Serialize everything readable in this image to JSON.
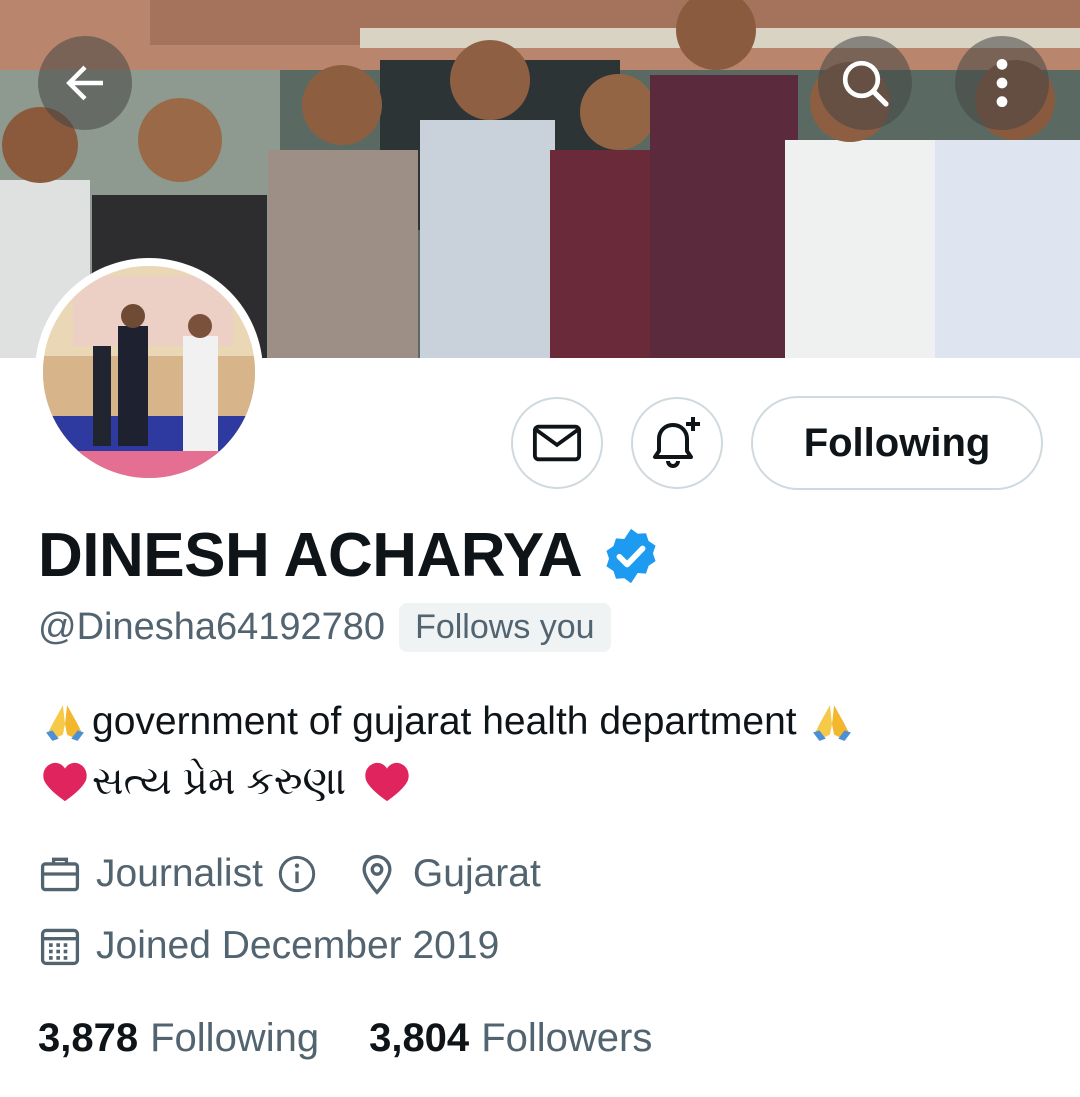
{
  "header": {
    "back_icon": "arrow-left-icon",
    "search_icon": "search-icon",
    "more_icon": "more-vertical-icon"
  },
  "actions": {
    "message_icon": "envelope-icon",
    "notify_icon": "bell-plus-icon",
    "following_label": "Following"
  },
  "profile": {
    "name": "DINESH ACHARYA",
    "verified_icon": "verified-badge-icon",
    "handle": "@Dinesha64192780",
    "follows_you": "Follows you",
    "bio_line1": "government of gujarat health department",
    "bio_line2": "સત્ય પ્રેમ કરુણા",
    "profession": "Journalist",
    "location": "Gujarat",
    "joined": "Joined December 2019"
  },
  "stats": {
    "following_count": "3,878",
    "following_label": "Following",
    "followers_count": "3,804",
    "followers_label": "Followers"
  },
  "colors": {
    "verified_blue": "#1d9bf0",
    "secondary_text": "#536471",
    "border": "#cfd9de",
    "heart_red": "#e0245e"
  }
}
